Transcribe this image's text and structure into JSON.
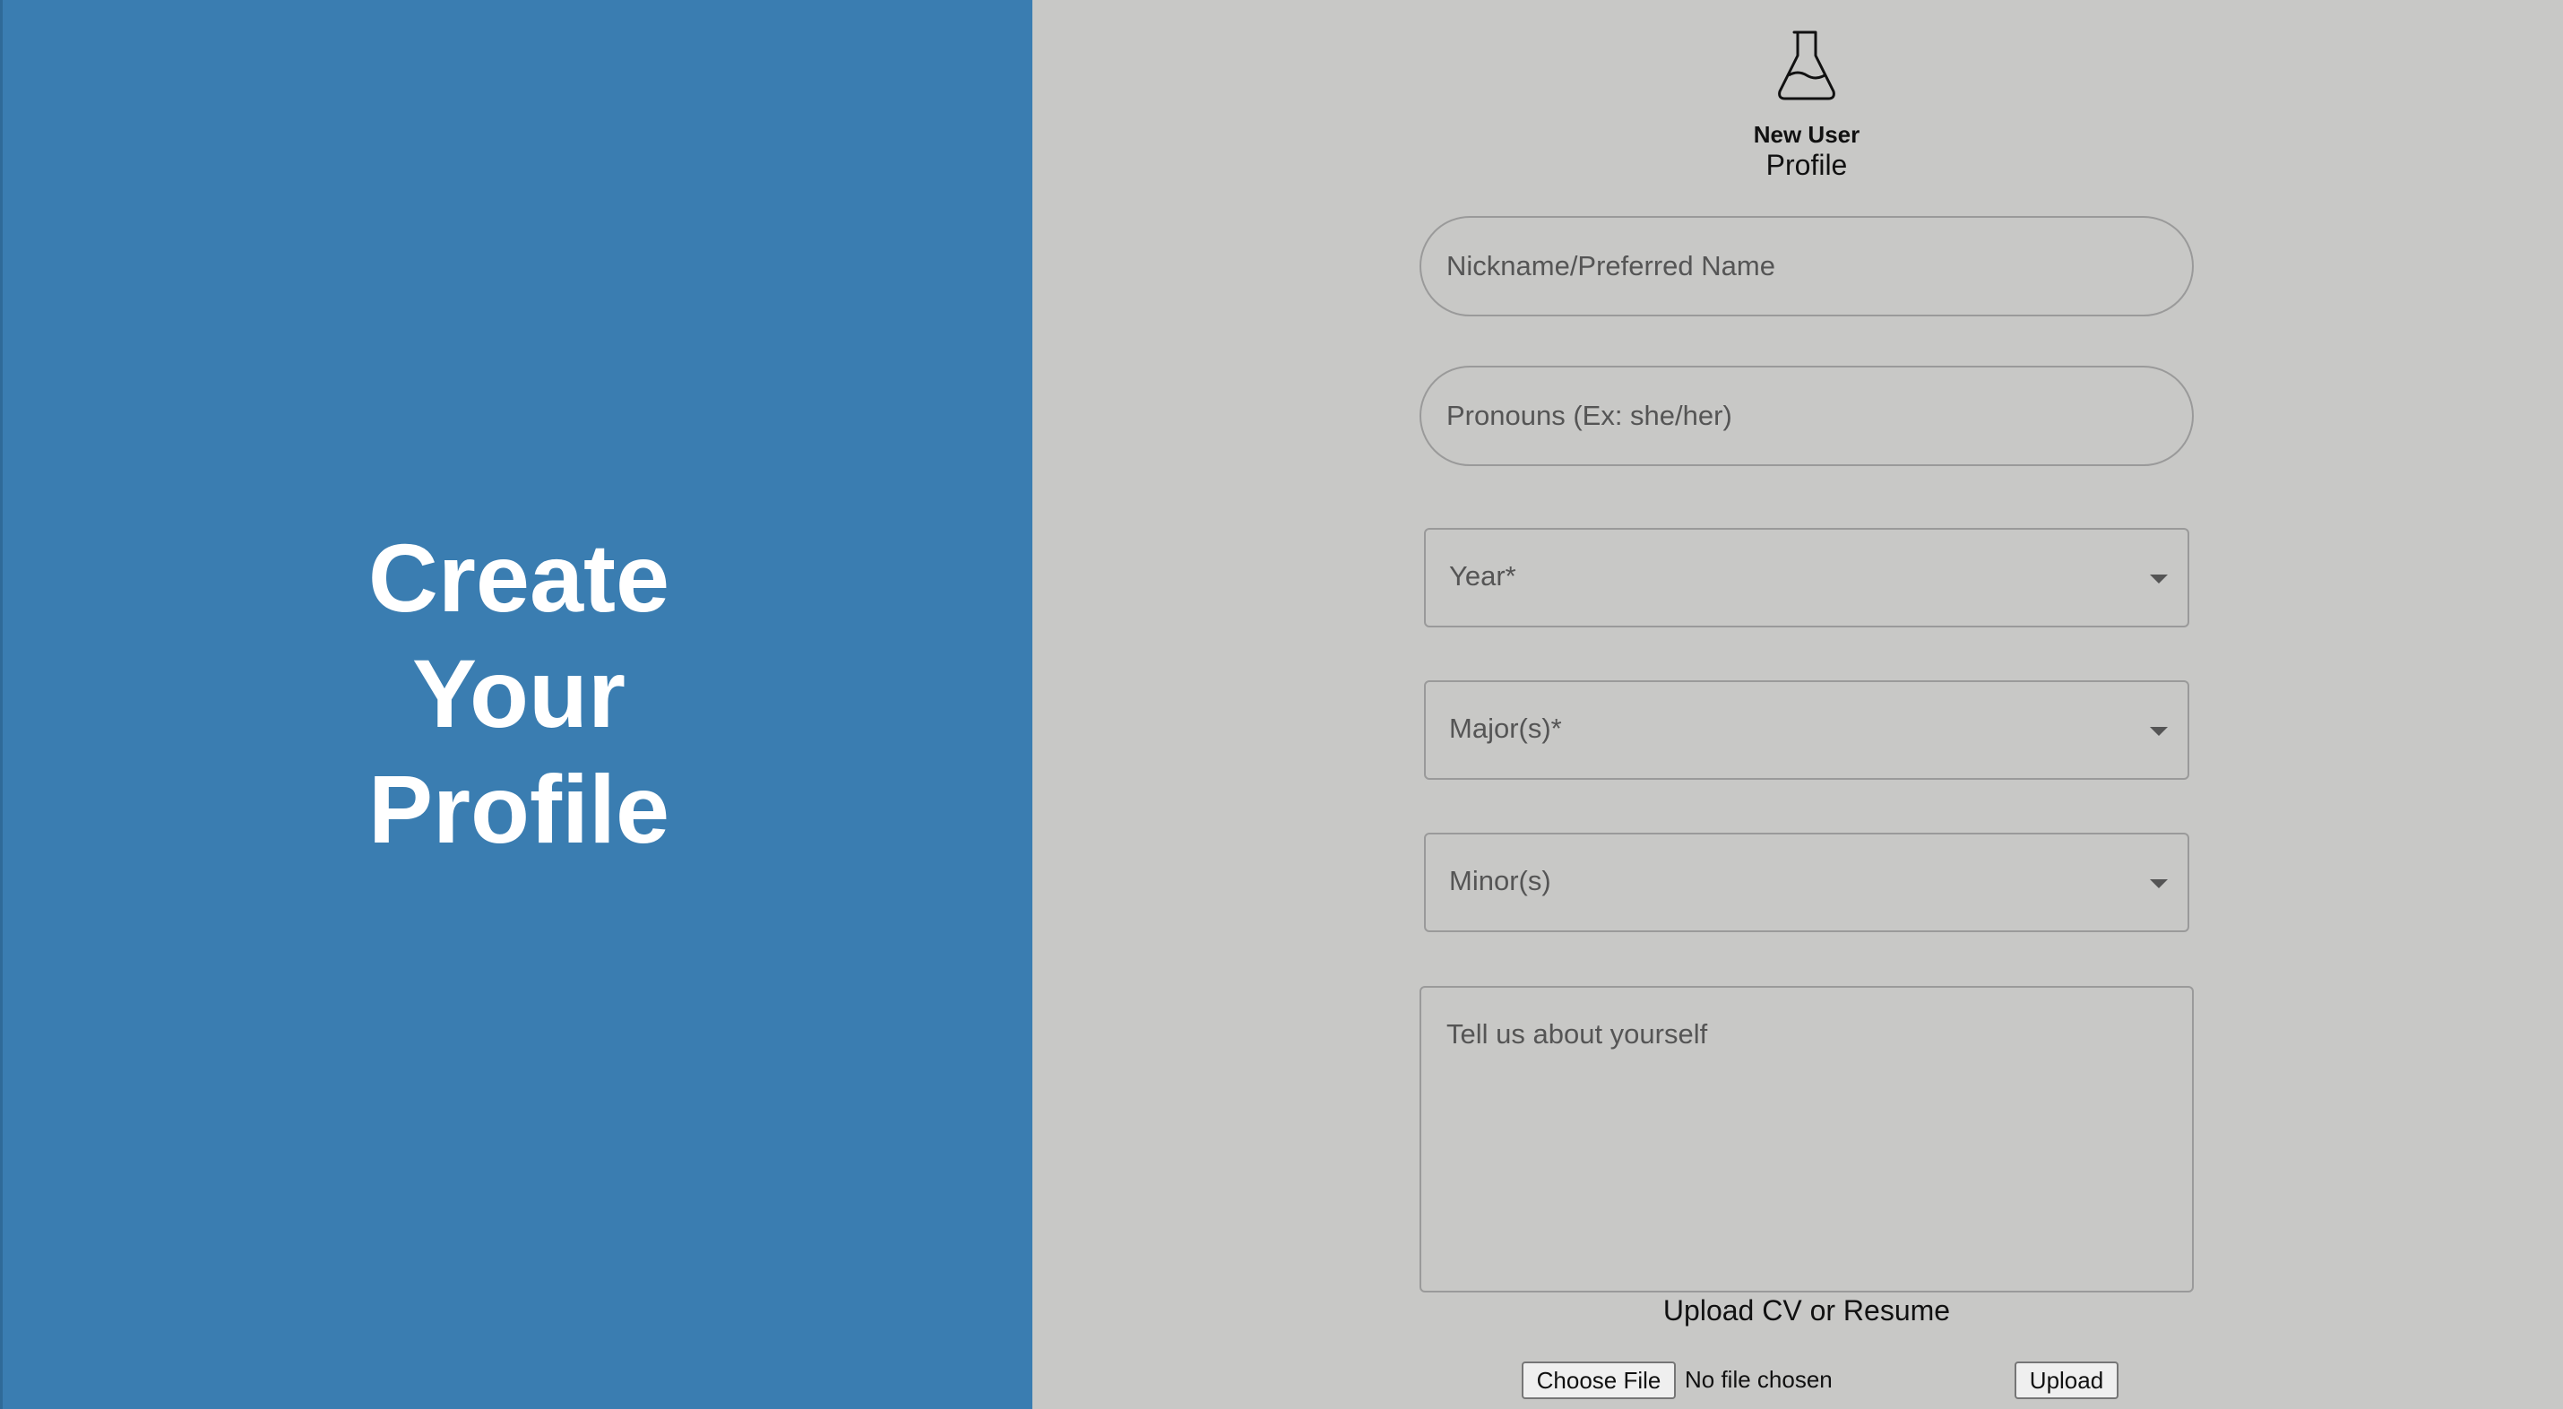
{
  "hero": {
    "line1": "Create",
    "line2": "Your",
    "line3": "Profile"
  },
  "header": {
    "logo_icon": "flask-icon",
    "subtitle_bold": "New User",
    "subtitle": "Profile"
  },
  "form": {
    "nickname_placeholder": "Nickname/Preferred Name",
    "pronouns_placeholder": "Pronouns (Ex: she/her)",
    "year_label": "Year",
    "year_required": "*",
    "major_label": "Major(s)",
    "major_required": "*",
    "minor_label": "Minor(s)",
    "about_placeholder": "Tell us about yourself",
    "upload_label": "Upload CV or Resume",
    "choose_file_label": "Choose File",
    "file_status": "No file chosen",
    "upload_button": "Upload"
  },
  "colors": {
    "left_panel": "#3a7db1",
    "right_panel": "#c8c8c6"
  }
}
